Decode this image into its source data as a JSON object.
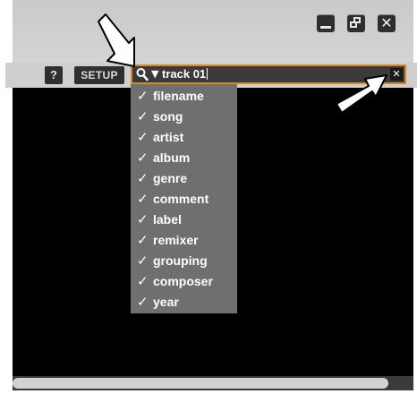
{
  "window": {
    "minimize_label": "minimize",
    "restore_label": "restore",
    "close_glyph": "✕"
  },
  "toolbar": {
    "help_label": "?",
    "setup_label": "SETUP"
  },
  "search": {
    "dropdown_glyph": "▼",
    "value": "track 01",
    "clear_glyph": "✕"
  },
  "field_filter": {
    "checkmark": "✓",
    "items": [
      {
        "label": "filename",
        "checked": true
      },
      {
        "label": "song",
        "checked": true
      },
      {
        "label": "artist",
        "checked": true
      },
      {
        "label": "album",
        "checked": true
      },
      {
        "label": "genre",
        "checked": true
      },
      {
        "label": "comment",
        "checked": true
      },
      {
        "label": "label",
        "checked": true
      },
      {
        "label": "remixer",
        "checked": true
      },
      {
        "label": "grouping",
        "checked": true
      },
      {
        "label": "composer",
        "checked": true
      },
      {
        "label": "year",
        "checked": true
      }
    ]
  },
  "colors": {
    "search_border": "#d88a1e",
    "panel_bg": "#cfcfcf",
    "results_bg": "#000000",
    "dropdown_bg": "#6f6f6f"
  },
  "icons": {
    "search": "magnifier-icon",
    "callout_arrows": "white-arrow-icon"
  }
}
